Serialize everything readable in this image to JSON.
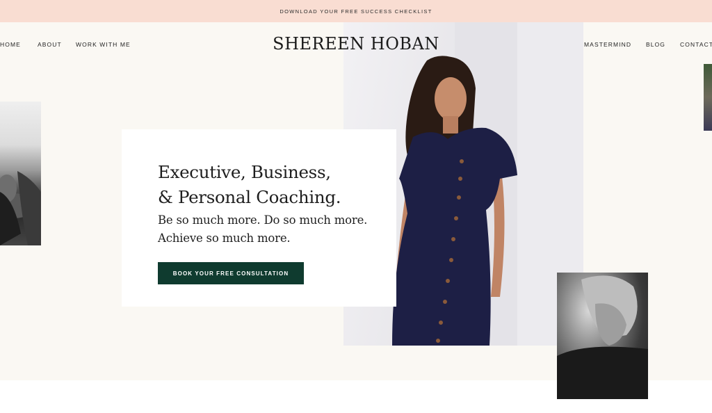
{
  "announcement": {
    "text": "DOWNLOAD YOUR FREE SUCCESS CHECKLIST"
  },
  "nav": {
    "left": [
      "HOME",
      "ABOUT",
      "WORK WITH ME"
    ],
    "right": [
      "MASTERMIND",
      "BLOG",
      "CONTACT"
    ]
  },
  "brand": {
    "logo": "SHEREEN HOBAN"
  },
  "hero": {
    "headline_line1": "Executive, Business,",
    "headline_line2": "& Personal Coaching.",
    "sub_line1": "Be so much more. Do so much more.",
    "sub_line2": "Achieve so much more.",
    "cta": "BOOK YOUR FREE CONSULTATION"
  },
  "colors": {
    "announcement_bg": "#f9ddd2",
    "hero_bg": "#faf8f3",
    "cta_bg": "#0f3b2f",
    "dress": "#1d1f45"
  }
}
